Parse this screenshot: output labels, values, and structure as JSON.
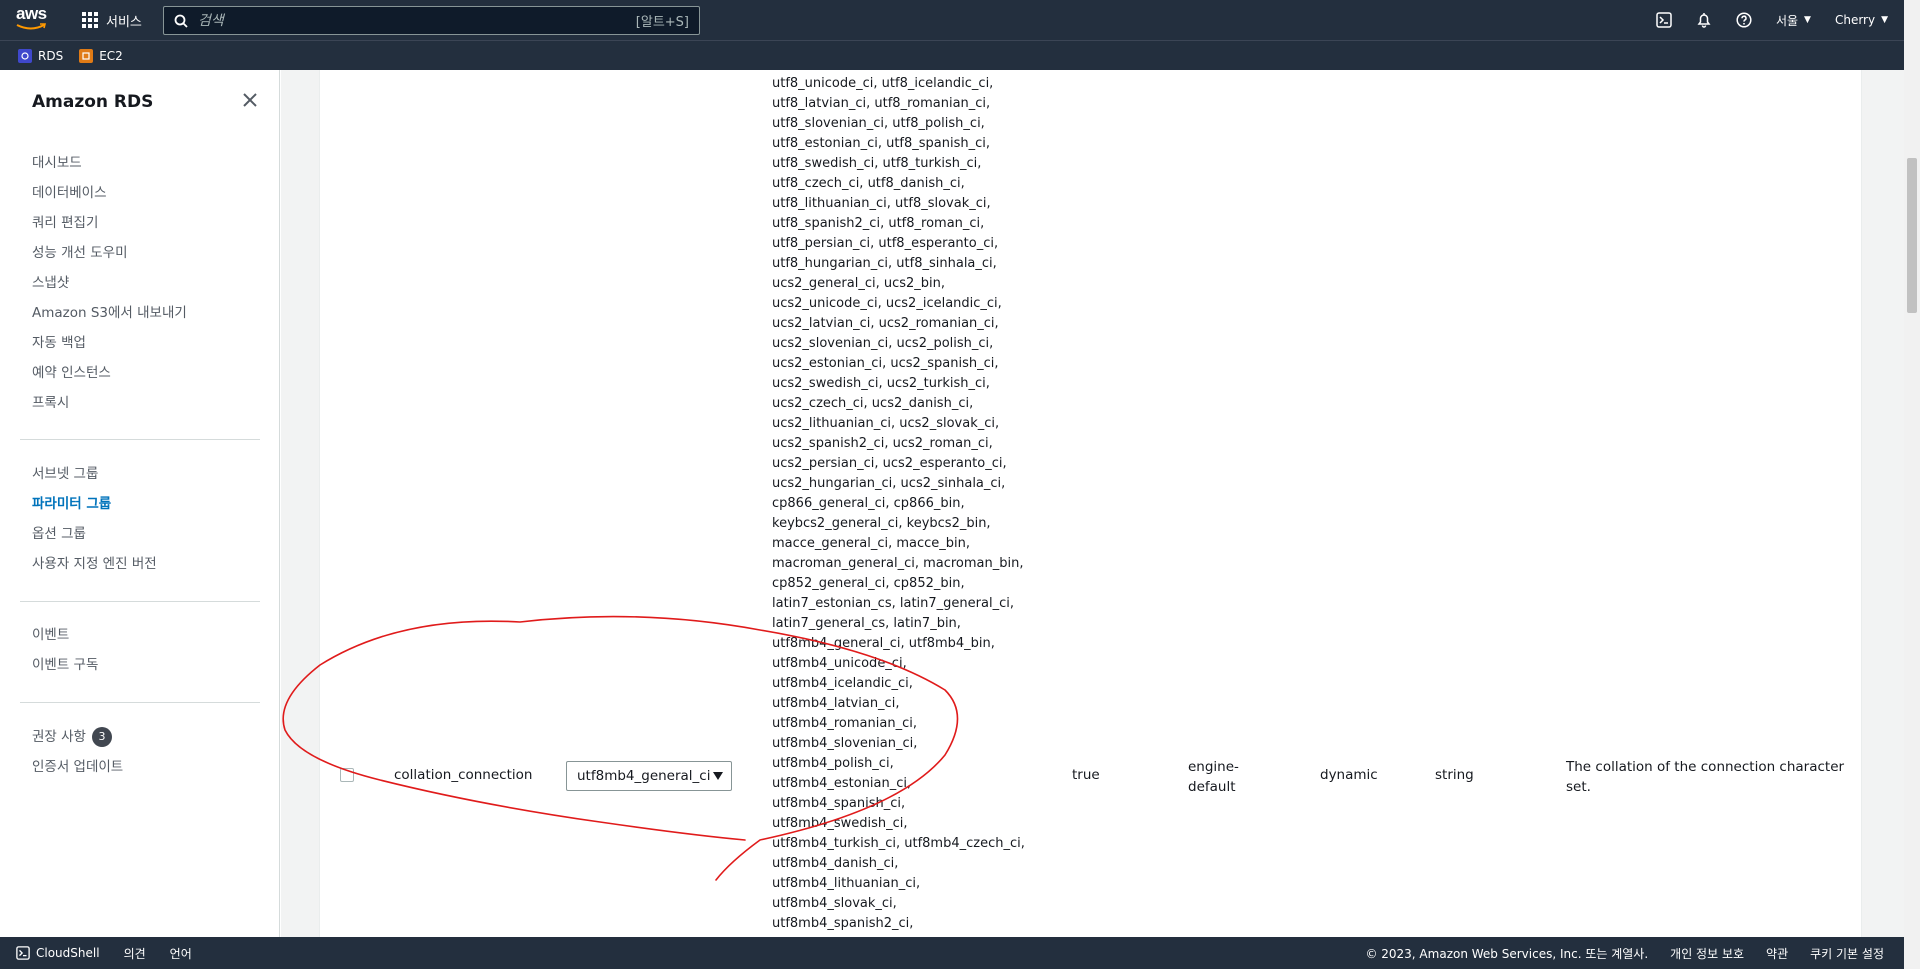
{
  "topnav": {
    "logo_text": "aws",
    "services_label": "서비스",
    "search_placeholder": "검색",
    "search_hint": "[알트+S]",
    "region_label": "서울",
    "user_label": "Cherry",
    "icons": [
      "cloudshell-icon",
      "bell-icon",
      "help-icon"
    ]
  },
  "favorites": [
    {
      "label": "RDS",
      "color": "#3f48cc"
    },
    {
      "label": "EC2",
      "color": "#e07b16"
    }
  ],
  "sidebar": {
    "title": "Amazon RDS",
    "group1": [
      "대시보드",
      "데이터베이스",
      "쿼리 편집기",
      "성능 개선 도우미",
      "스냅샷",
      "Amazon S3에서 내보내기",
      "자동 백업",
      "예약 인스턴스",
      "프록시"
    ],
    "group2": [
      "서브넷 그룹",
      "파라미터 그룹",
      "옵션 그룹",
      "사용자 지정 엔진 버전"
    ],
    "group3": [
      "이벤트",
      "이벤트 구독"
    ],
    "group4_item1": "권장 사항",
    "group4_badge": "3",
    "group4_item2": "인증서 업데이트",
    "active_item": "파라미터 그룹"
  },
  "row": {
    "name": "collation_connection",
    "selected_value": "utf8mb4_general_ci",
    "modifiable": "true",
    "source_line1": "engine-",
    "source_line2": "default",
    "apply_type": "dynamic",
    "data_type": "string",
    "description_line1": "The collation of the connection character",
    "description_line2": "set."
  },
  "allowed_values": [
    "utf8_unicode_ci, utf8_icelandic_ci,",
    "utf8_latvian_ci, utf8_romanian_ci,",
    "utf8_slovenian_ci, utf8_polish_ci,",
    "utf8_estonian_ci, utf8_spanish_ci,",
    "utf8_swedish_ci, utf8_turkish_ci,",
    "utf8_czech_ci, utf8_danish_ci,",
    "utf8_lithuanian_ci, utf8_slovak_ci,",
    "utf8_spanish2_ci, utf8_roman_ci,",
    "utf8_persian_ci, utf8_esperanto_ci,",
    "utf8_hungarian_ci, utf8_sinhala_ci,",
    "ucs2_general_ci, ucs2_bin,",
    "ucs2_unicode_ci, ucs2_icelandic_ci,",
    "ucs2_latvian_ci, ucs2_romanian_ci,",
    "ucs2_slovenian_ci, ucs2_polish_ci,",
    "ucs2_estonian_ci, ucs2_spanish_ci,",
    "ucs2_swedish_ci, ucs2_turkish_ci,",
    "ucs2_czech_ci, ucs2_danish_ci,",
    "ucs2_lithuanian_ci, ucs2_slovak_ci,",
    "ucs2_spanish2_ci, ucs2_roman_ci,",
    "ucs2_persian_ci, ucs2_esperanto_ci,",
    "ucs2_hungarian_ci, ucs2_sinhala_ci,",
    "cp866_general_ci, cp866_bin,",
    "keybcs2_general_ci, keybcs2_bin,",
    "macce_general_ci, macce_bin,",
    "macroman_general_ci, macroman_bin,",
    "cp852_general_ci, cp852_bin,",
    "latin7_estonian_cs, latin7_general_ci,",
    "latin7_general_cs, latin7_bin,",
    "utf8mb4_general_ci, utf8mb4_bin,",
    "utf8mb4_unicode_ci,",
    "utf8mb4_icelandic_ci,",
    "utf8mb4_latvian_ci,",
    "utf8mb4_romanian_ci,",
    "utf8mb4_slovenian_ci,",
    "utf8mb4_polish_ci,",
    "utf8mb4_estonian_ci,",
    "utf8mb4_spanish_ci,",
    "utf8mb4_swedish_ci,",
    "utf8mb4_turkish_ci, utf8mb4_czech_ci,",
    "utf8mb4_danish_ci,",
    "utf8mb4_lithuanian_ci,",
    "utf8mb4_slovak_ci,",
    "utf8mb4_spanish2_ci,"
  ],
  "footer": {
    "cloudshell_label": "CloudShell",
    "feedback_label": "의견",
    "language_label": "언어",
    "copyright": "© 2023, Amazon Web Services, Inc. 또는 계열사.",
    "privacy": "개인 정보 보호",
    "terms": "약관",
    "cookies": "쿠키 기본 설정"
  },
  "colors": {
    "nav_bg": "#232f3e",
    "active_link": "#0073bb",
    "annotation": "#e01b1b"
  }
}
